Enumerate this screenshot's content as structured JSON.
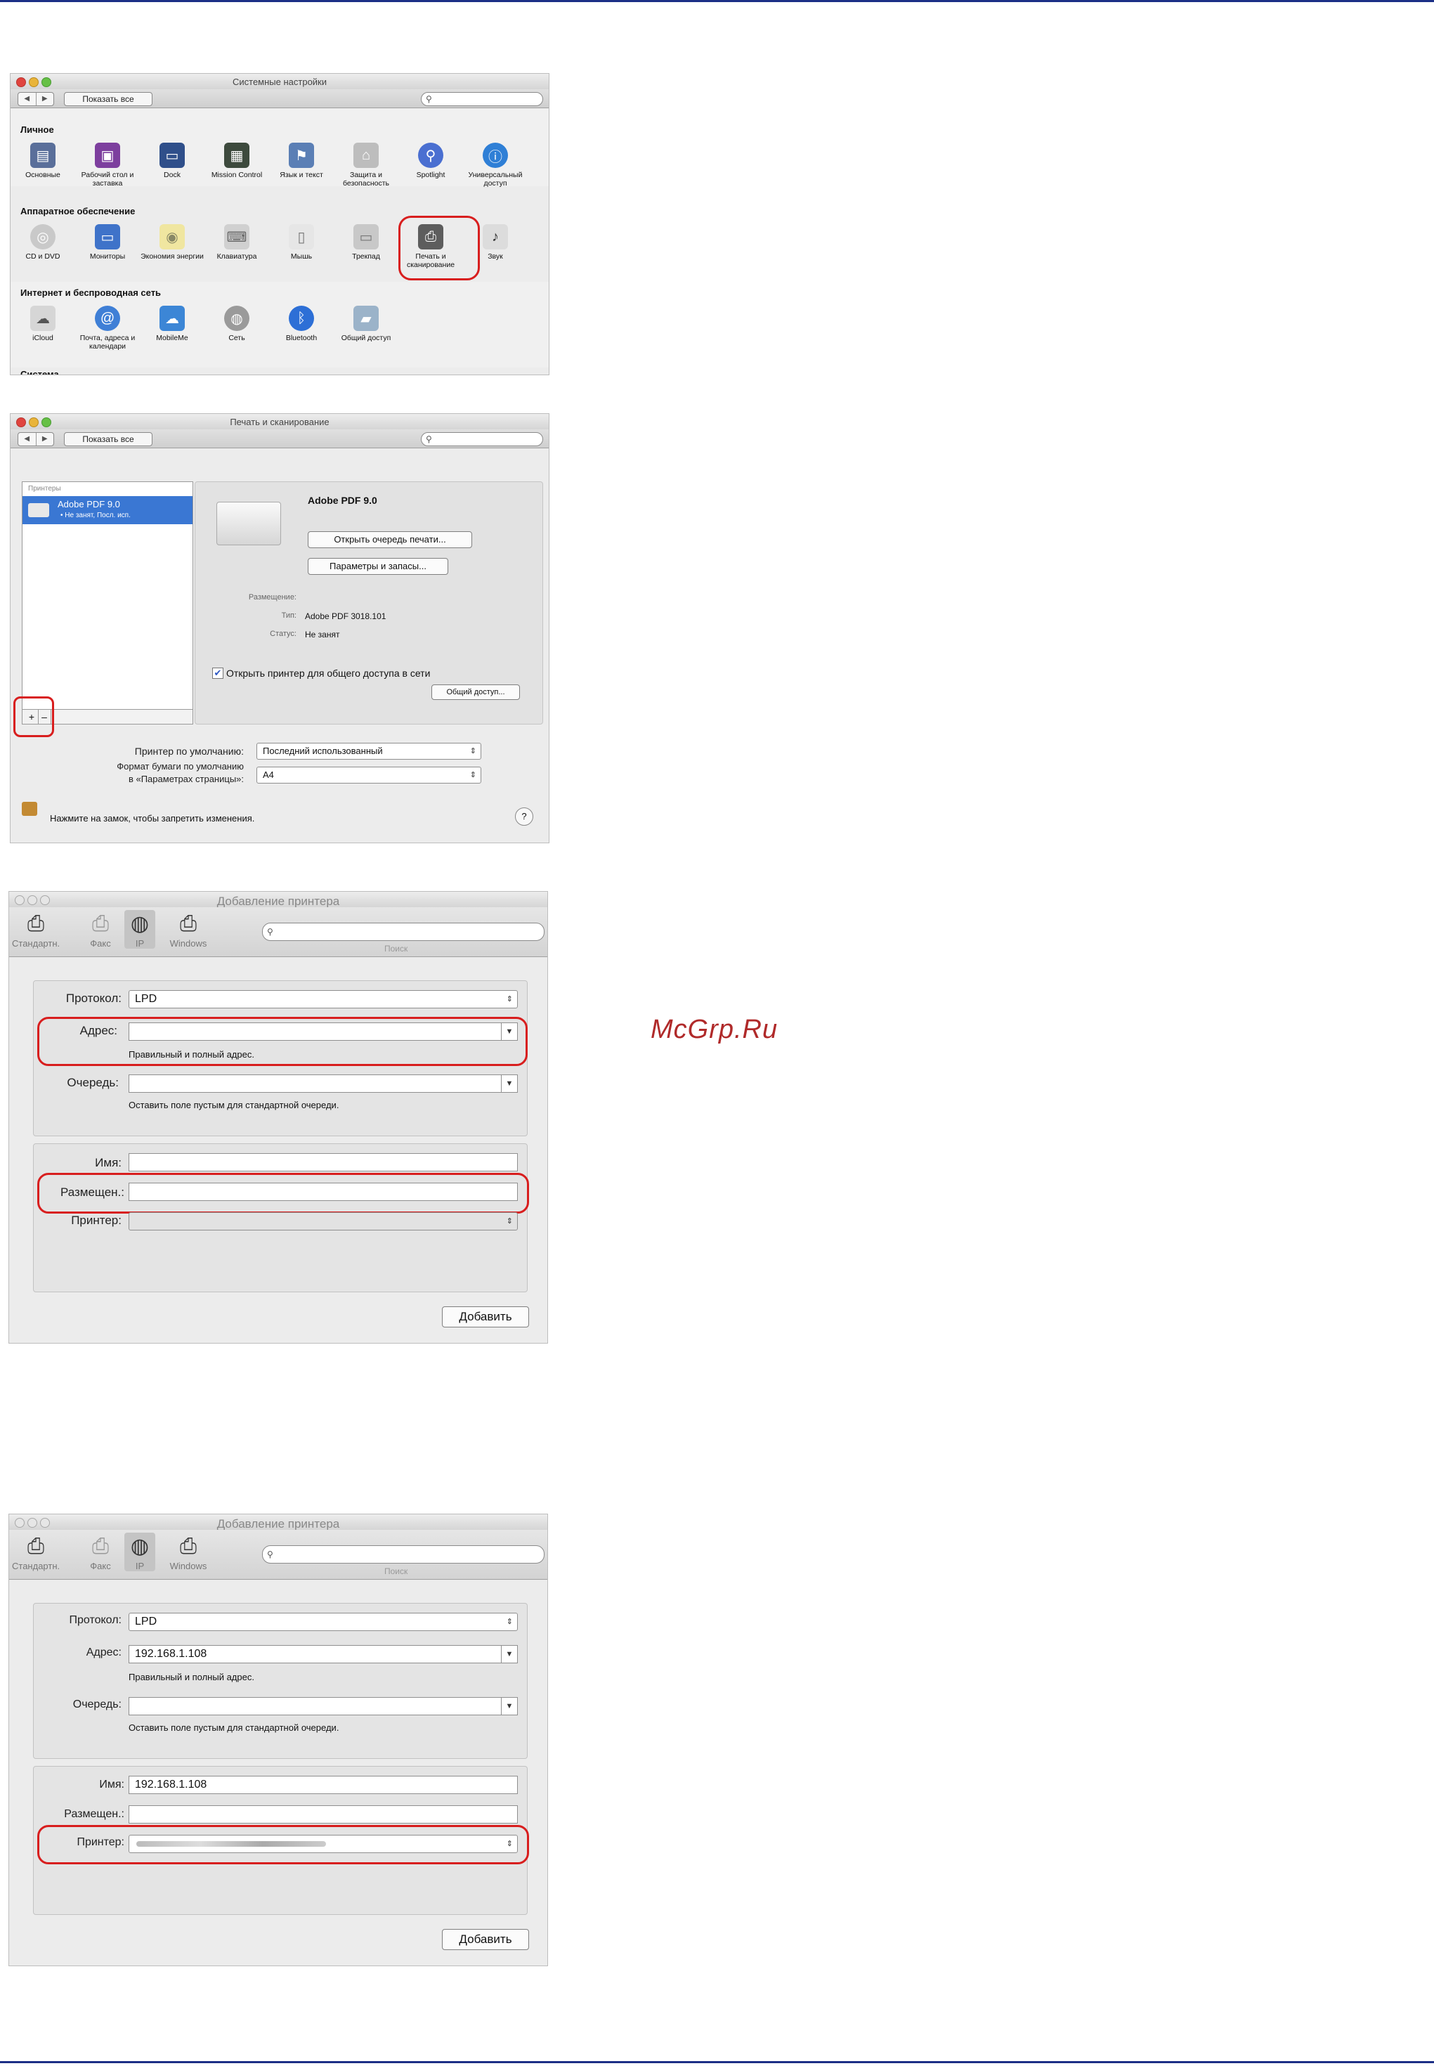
{
  "watermark": "McGrp.Ru",
  "s1": {
    "title": "Системные настройки",
    "show_all": "Показать все",
    "sections": [
      "Личное",
      "Аппаратное обеспечение",
      "Интернет и беспроводная сеть",
      "Система"
    ],
    "personal": [
      "Основные",
      "Рабочий стол и заставка",
      "Dock",
      "Mission Control",
      "Язык и текст",
      "Защита и безопасность",
      "Spotlight",
      "Универсальный доступ"
    ],
    "hardware": [
      "CD и DVD",
      "Мониторы",
      "Экономия энергии",
      "Клавиатура",
      "Мышь",
      "Трекпад",
      "Печать и сканирование",
      "Звук"
    ],
    "internet": [
      "iCloud",
      "Почта, адреса и календари",
      "MobileMe",
      "Сеть",
      "Bluetooth",
      "Общий доступ"
    ]
  },
  "s2": {
    "title": "Печать и сканирование",
    "show_all": "Показать все",
    "list_header": "Принтеры",
    "printer_name": "Adobe PDF 9.0",
    "printer_status": "• Не занят, Посл. исп.",
    "detail_name": "Adobe PDF 9.0",
    "open_queue": "Открыть очередь печати...",
    "options": "Параметры и запасы...",
    "location_label": "Размещение:",
    "type_label": "Тип:",
    "type_value": "Adobe PDF 3018.101",
    "status_label": "Статус:",
    "status_value": "Не занят",
    "share_checkbox": "Открыть принтер для общего доступа в сети",
    "share_button": "Общий доступ...",
    "plus": "+",
    "minus": "–",
    "default_printer_label": "Принтер по умолчанию:",
    "default_printer_value": "Последний использованный",
    "paper_label_1": "Формат бумаги по умолчанию",
    "paper_label_2": "в «Параметрах страницы»:",
    "paper_value": "A4",
    "lock_text": "Нажмите на замок, чтобы запретить изменения.",
    "help": "?"
  },
  "s3": {
    "title": "Добавление принтера",
    "tools": [
      "Стандартн.",
      "Факс",
      "IP",
      "Windows"
    ],
    "search_label": "Поиск",
    "protocol_label": "Протокол:",
    "protocol_value": "LPD",
    "address_label": "Адрес:",
    "address_value": "",
    "address_hint": "Правильный и полный адрес.",
    "queue_label": "Очередь:",
    "queue_hint": "Оставить поле пустым для стандартной очереди.",
    "name_label": "Имя:",
    "name_value": "",
    "location_label": "Размещен.:",
    "printer_label": "Принтер:",
    "add_button": "Добавить"
  },
  "s4": {
    "title": "Добавление принтера",
    "tools": [
      "Стандартн.",
      "Факс",
      "IP",
      "Windows"
    ],
    "search_label": "Поиск",
    "protocol_label": "Протокол:",
    "protocol_value": "LPD",
    "address_label": "Адрес:",
    "address_value": "192.168.1.108",
    "address_hint": "Правильный и полный адрес.",
    "queue_label": "Очередь:",
    "queue_hint": "Оставить поле пустым для стандартной очереди.",
    "name_label": "Имя:",
    "name_value": "192.168.1.108",
    "location_label": "Размещен.:",
    "printer_label": "Принтер:",
    "add_button": "Добавить"
  }
}
